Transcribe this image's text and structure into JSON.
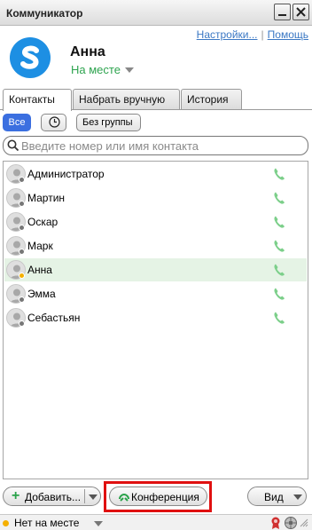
{
  "window": {
    "title": "Коммуникатор"
  },
  "header": {
    "links": {
      "settings": "Настройки...",
      "separator": "|",
      "help": "Помощь"
    },
    "user": {
      "name": "Анна",
      "presence": "На месте"
    },
    "colors": {
      "logo": "#1d8fe3",
      "presence": "#2ea44f"
    }
  },
  "tabs": [
    {
      "label": "Контакты",
      "active": true
    },
    {
      "label": "Набрать вручную",
      "active": false
    },
    {
      "label": "История",
      "active": false
    }
  ],
  "filters": {
    "all": "Все",
    "recent_icon": "clock-icon",
    "no_group": "Без группы"
  },
  "search": {
    "placeholder": "Введите номер или имя контакта"
  },
  "contacts": [
    {
      "name": "Администратор",
      "status": "offline",
      "selected": false
    },
    {
      "name": "Мартин",
      "status": "offline",
      "selected": false
    },
    {
      "name": "Оскар",
      "status": "offline",
      "selected": false
    },
    {
      "name": "Марк",
      "status": "offline",
      "selected": false
    },
    {
      "name": "Анна",
      "status": "away",
      "selected": true
    },
    {
      "name": "Эмма",
      "status": "offline",
      "selected": false
    },
    {
      "name": "Себастьян",
      "status": "offline",
      "selected": false
    }
  ],
  "bottombar": {
    "add": "Добавить...",
    "conference": "Конференция",
    "view": "Вид"
  },
  "statusbar": {
    "status": "Нет на месте"
  },
  "colors": {
    "accent": "#3b6fe0",
    "highlight": "#e01010",
    "phone": "#7ccf8a",
    "away": "#f4b000"
  }
}
